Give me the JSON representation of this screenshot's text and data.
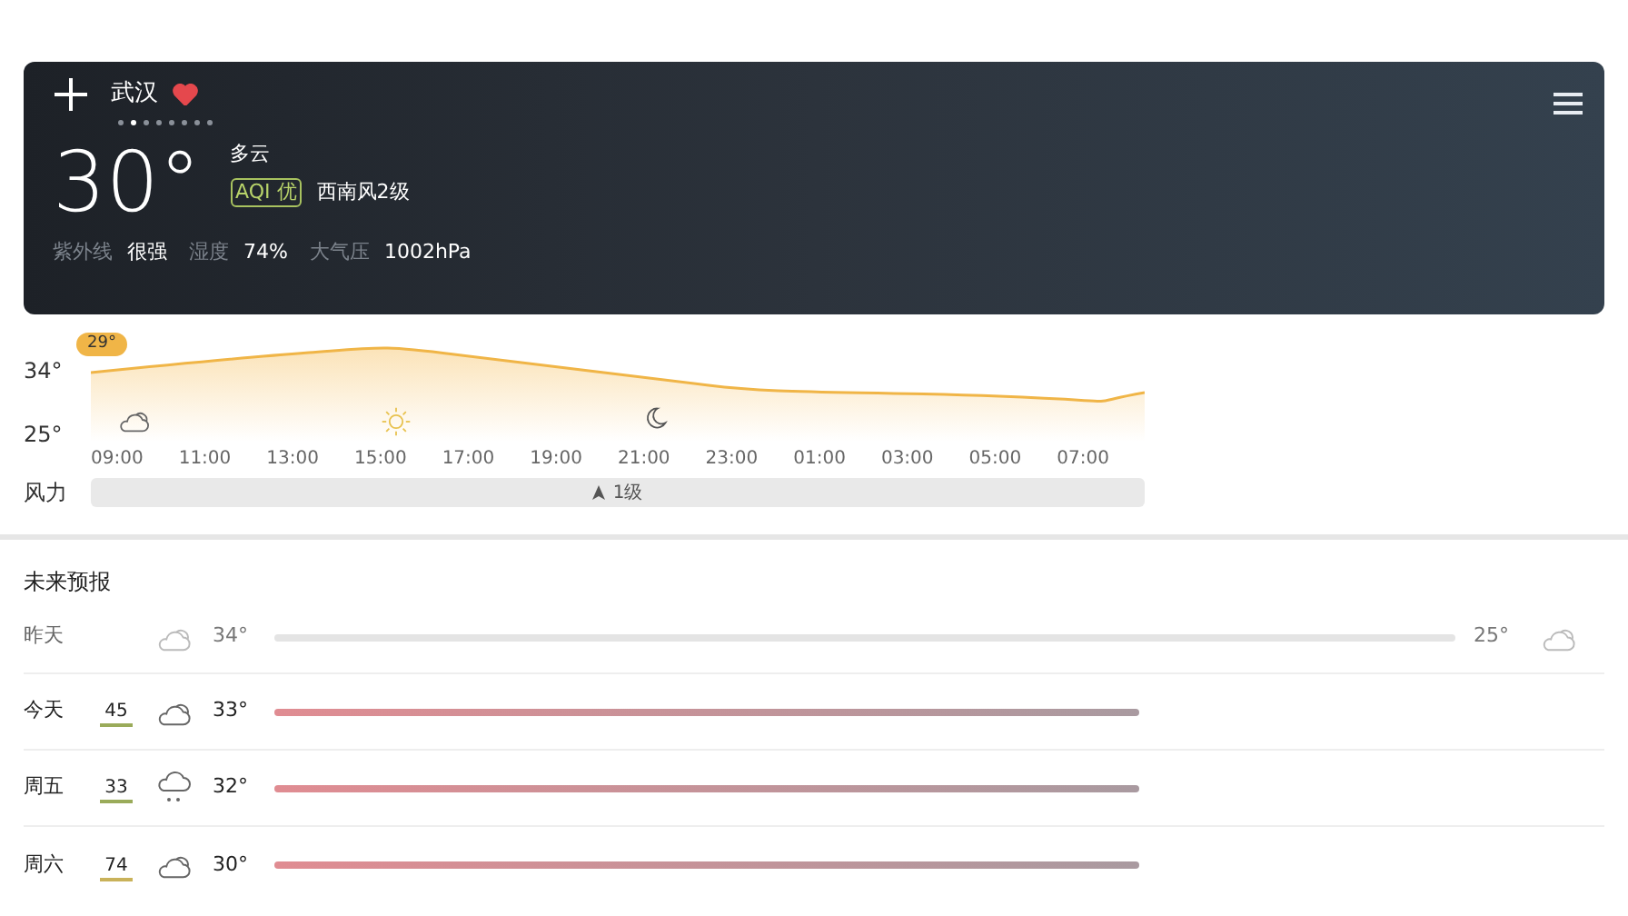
{
  "header": {
    "city": "武汉",
    "favorite": true,
    "page_dots": [
      {
        "selected": false
      },
      {
        "selected": true
      },
      {
        "selected": false
      },
      {
        "selected": false
      },
      {
        "selected": false
      },
      {
        "selected": false
      },
      {
        "selected": false
      },
      {
        "selected": false
      }
    ],
    "temperature": "30°",
    "condition": "多云",
    "aqi": "AQI 优",
    "wind": "西南风2级",
    "details": [
      {
        "label": "紫外线",
        "value": "很强"
      },
      {
        "label": "湿度",
        "value": "74%"
      },
      {
        "label": "大气压",
        "value": "1002hPa"
      }
    ]
  },
  "hourly": {
    "y_labels": [
      "34°",
      "25°"
    ],
    "current_badge": "29°",
    "hours": [
      {
        "time": "09:00",
        "icon": {
          "kind": "cloudy"
        }
      },
      {
        "time": "11:00"
      },
      {
        "time": "13:00"
      },
      {
        "time": "15:00",
        "icon": {
          "kind": "sun"
        }
      },
      {
        "time": "17:00"
      },
      {
        "time": "19:00"
      },
      {
        "time": "21:00",
        "icon": {
          "kind": "moon"
        }
      },
      {
        "time": "23:00"
      },
      {
        "time": "01:00"
      },
      {
        "time": "03:00"
      },
      {
        "time": "05:00"
      },
      {
        "time": "07:00"
      }
    ],
    "wind_label": "风力",
    "wind_value": "1级"
  },
  "forecast": {
    "title": "未来预报",
    "days": [
      {
        "day": "昨天",
        "kind": "past",
        "icon": {
          "kind": "cloudy"
        },
        "high": "34°",
        "low": "25°",
        "low_icon": {
          "kind": "cloudy"
        }
      },
      {
        "day": "今天",
        "kind": "future",
        "aqi": {
          "value": "45",
          "color": "#9aab5a"
        },
        "icon": {
          "kind": "cloudy"
        },
        "high": "33°"
      },
      {
        "day": "周五",
        "kind": "future",
        "aqi": {
          "value": "33",
          "color": "#9aab5a"
        },
        "icon": {
          "kind": "rain"
        },
        "high": "32°"
      },
      {
        "day": "周六",
        "kind": "future",
        "aqi": {
          "value": "74",
          "color": "#c9b25a"
        },
        "icon": {
          "kind": "cloudy"
        },
        "high": "30°"
      }
    ]
  }
}
